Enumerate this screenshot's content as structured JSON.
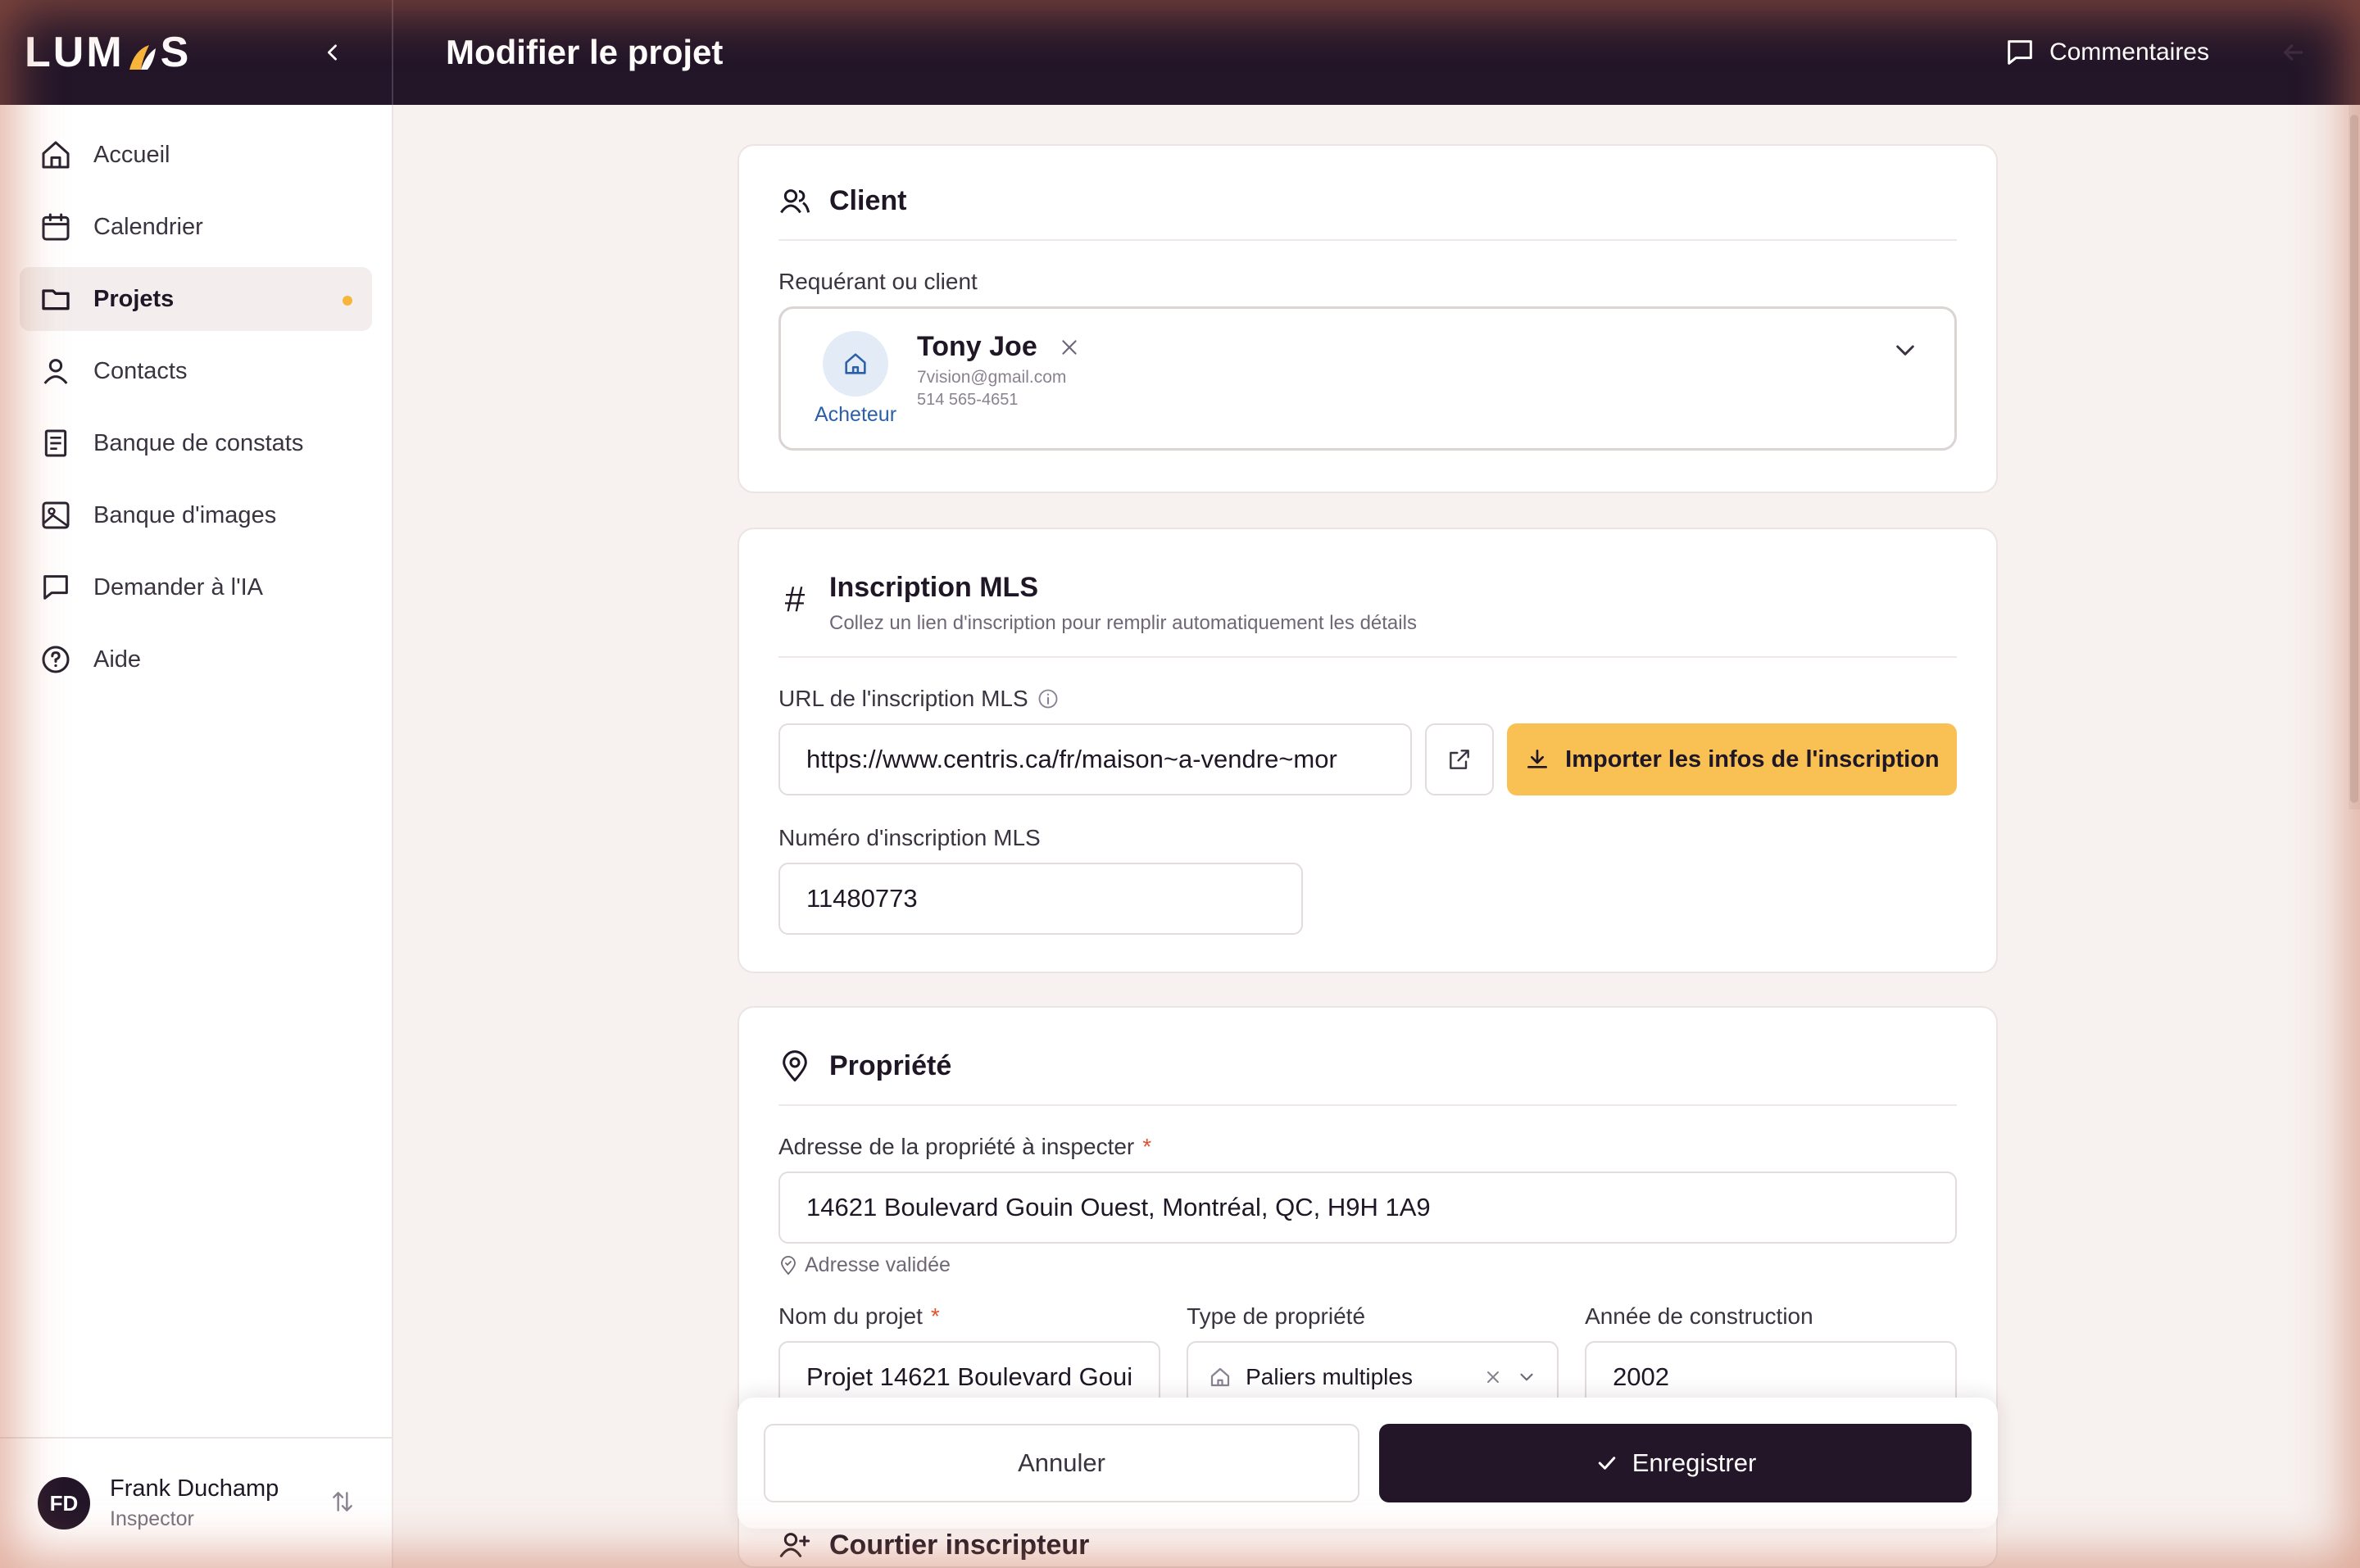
{
  "app": {
    "logo": "LUMOS",
    "page_title": "Modifier le projet",
    "comments_label": "Commentaires"
  },
  "sidebar": {
    "items": [
      {
        "label": "Accueil",
        "icon": "home-icon"
      },
      {
        "label": "Calendrier",
        "icon": "calendar-icon"
      },
      {
        "label": "Projets",
        "icon": "folder-icon",
        "active": true
      },
      {
        "label": "Contacts",
        "icon": "user-icon"
      },
      {
        "label": "Banque de constats",
        "icon": "document-icon"
      },
      {
        "label": "Banque d'images",
        "icon": "image-icon"
      },
      {
        "label": "Demander à l'IA",
        "icon": "chat-icon"
      },
      {
        "label": "Aide",
        "icon": "help-icon"
      }
    ],
    "user": {
      "initials": "FD",
      "name": "Frank Duchamp",
      "role": "Inspector"
    }
  },
  "client": {
    "title": "Client",
    "field_label": "Requérant ou client",
    "name": "Tony Joe",
    "email": "7vision@gmail.com",
    "phone": "514 565-4651",
    "role": "Acheteur"
  },
  "mls": {
    "title": "Inscription MLS",
    "subtitle": "Collez un lien d'inscription pour remplir automatiquement les détails",
    "url_label": "URL de l'inscription MLS",
    "url_value": "https://www.centris.ca/fr/maison~a-vendre~mor",
    "import_label": "Importer les infos de l'inscription",
    "number_label": "Numéro d'inscription MLS",
    "number_value": "11480773"
  },
  "property": {
    "title": "Propriété",
    "address_label": "Adresse de la propriété à inspecter",
    "address_value": "14621 Boulevard Gouin Ouest, Montréal, QC, H9H 1A9",
    "address_status": "Adresse validée",
    "project_name_label": "Nom du projet",
    "project_name_value": "Projet 14621 Boulevard Goui",
    "type_label": "Type de propriété",
    "type_value": "Paliers multiples",
    "year_label": "Année de construction",
    "year_value": "2002",
    "required_mark": "*"
  },
  "broker": {
    "title": "Courtier inscripteur"
  },
  "actions": {
    "cancel": "Annuler",
    "save": "Enregistrer"
  },
  "colors": {
    "header": "#231629",
    "accent": "#f9c153",
    "required": "#e0532e",
    "link": "#2c5fa8"
  }
}
